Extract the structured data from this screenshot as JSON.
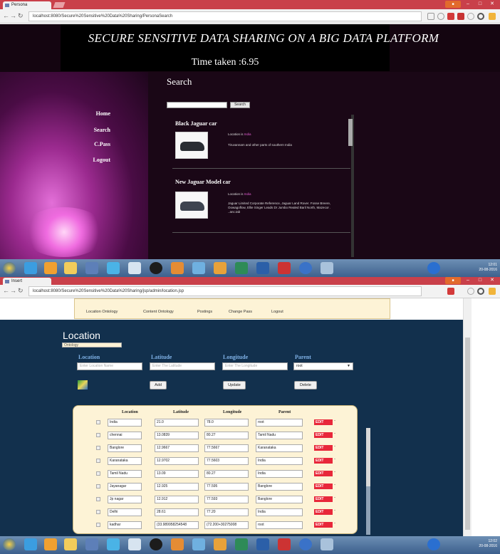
{
  "top_window": {
    "tab_title": "Persona",
    "address": "localhost:8080/Secure%20Sensitive%20Data%20Sharing/PersonaSearch",
    "page_title": "SECURE SENSITIVE DATA SHARING ON A BIG DATA PLATFORM",
    "time_taken": "Time taken :6.95",
    "sidebar_links": [
      "Home",
      "Search",
      "C.Pass",
      "Logout"
    ],
    "search_heading": "Search",
    "search_button": "Search",
    "results": [
      {
        "title": "Black Jaguar car",
        "location_label": "Location is",
        "location": "India",
        "desc": "Tiruvannam and other parts of southern India"
      },
      {
        "title": "New Jaguar Model car",
        "location_label": "Location is",
        "location": "India",
        "desc": "Jaguar Limited Corporate Reference, Jaguar Land Rover. Fosse Breere, Oowagoflow, Ellie Singer Leads Dr Jumbo Realed Baril North, Mazecor . ..anc.tab"
      }
    ]
  },
  "taskbar": {
    "clock_time": "12:01",
    "clock_date": "20-08-2016"
  },
  "bottom_window": {
    "tab_title": "Insert",
    "address": "localhost:8080/Secure%20Sensitive%20Data%20Sharing/jsp/admin/location.jsp",
    "menu": [
      "Location Ontology",
      "Content Ontology",
      "Postings",
      "Change Pass",
      "Logout"
    ],
    "heading": "Location",
    "ontology_field": "Ontology",
    "labels": {
      "location": "Location",
      "latitude": "Latitude",
      "longitude": "Longitude",
      "parent": "Parent"
    },
    "placeholders": {
      "location": "Enter Location Name",
      "latitude": "Enter The Latitude",
      "longitude": "Enter The Longitude"
    },
    "parent_selected": "root",
    "buttons": {
      "add": "Add",
      "update": "Update",
      "delete": "Delete"
    },
    "table_headers": [
      "Location",
      "Latitude",
      "Longitude",
      "Parent"
    ],
    "rows": [
      [
        "India",
        "21.0",
        "78.0",
        "root"
      ],
      [
        "chennai",
        "13.0839",
        "80.27",
        "Tamil Nadu"
      ],
      [
        "Banglore",
        "12.9667",
        "77.5667",
        "Karanataka"
      ],
      [
        "Karanataka",
        "12.9702",
        "77.5603",
        "India"
      ],
      [
        "Tamil Nadu",
        "13.09",
        "80.27",
        "India"
      ],
      [
        "Jayanagar",
        "12.925",
        "77.595",
        "Banglore"
      ],
      [
        "Jp nagar",
        "12.912",
        "77.593",
        "Banglore"
      ],
      [
        "Delhi",
        "28.61",
        "77.20",
        "India"
      ],
      [
        "kadhar",
        "(33.989958254548",
        "(72.200+30275008",
        "root"
      ]
    ],
    "edit_label": "EDIT"
  },
  "taskbar2": {
    "clock_time": "12:02",
    "clock_date": "20-08-2016"
  }
}
